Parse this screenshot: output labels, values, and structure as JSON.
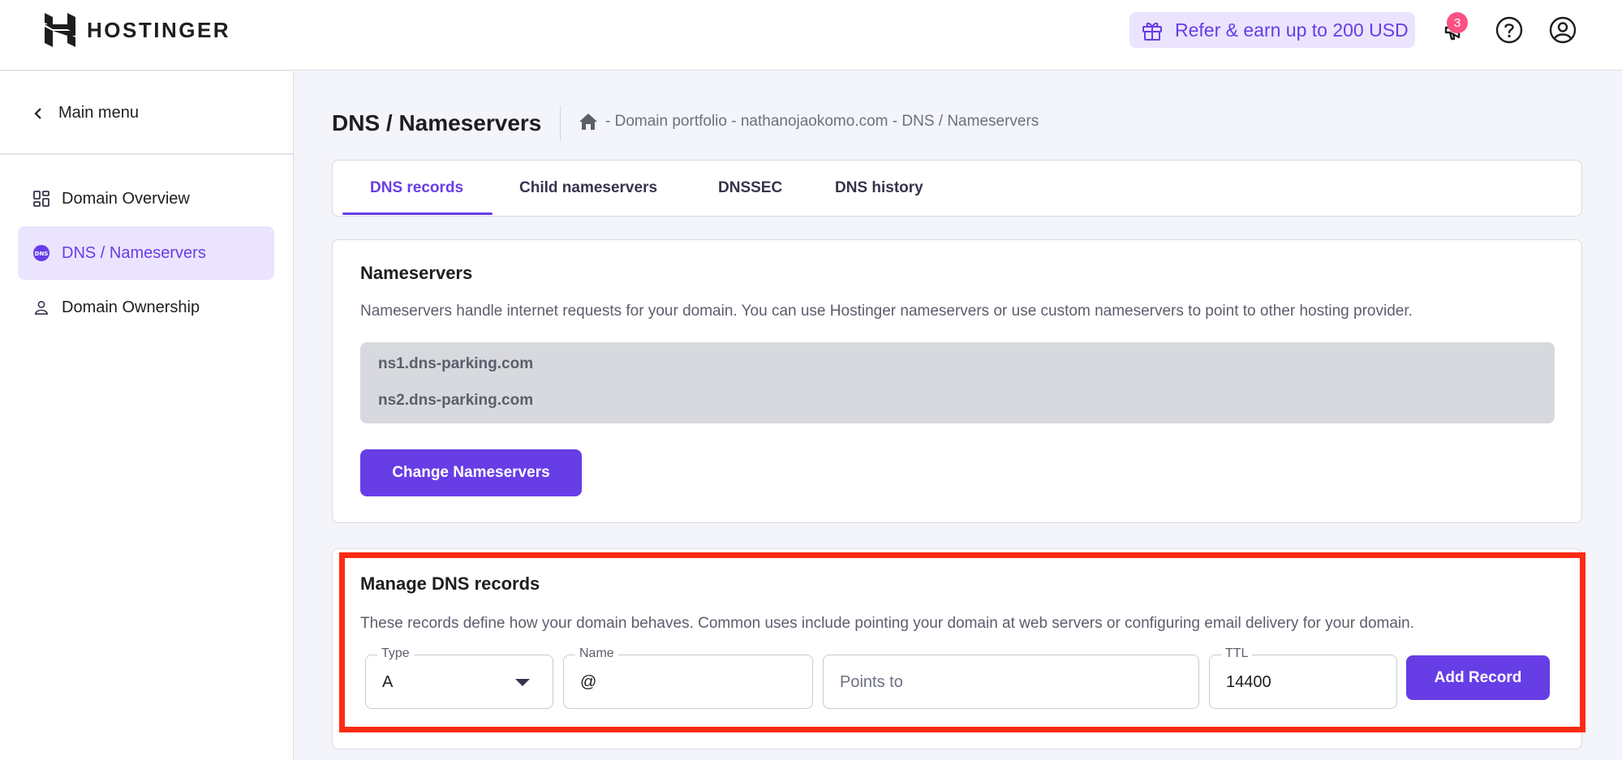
{
  "brand": {
    "name": "HOSTINGER"
  },
  "topbar": {
    "refer_label": "Refer & earn up to 200 USD",
    "notification_count": "3"
  },
  "sidebar": {
    "main_menu": "Main menu",
    "items": [
      {
        "label": "Domain Overview",
        "icon": "grid-icon",
        "active": false
      },
      {
        "label": "DNS / Nameservers",
        "icon": "dns-icon",
        "active": true
      },
      {
        "label": "Domain Ownership",
        "icon": "user-icon",
        "active": false
      }
    ]
  },
  "header": {
    "title": "DNS / Nameservers",
    "breadcrumb": "- Domain portfolio - nathanojaokomo.com - DNS / Nameservers"
  },
  "tabs": [
    {
      "label": "DNS records",
      "active": true
    },
    {
      "label": "Child nameservers",
      "active": false
    },
    {
      "label": "DNSSEC",
      "active": false
    },
    {
      "label": "DNS history",
      "active": false
    }
  ],
  "nameservers": {
    "title": "Nameservers",
    "description": "Nameservers handle internet requests for your domain. You can use Hostinger nameservers or use custom nameservers to point to other hosting provider.",
    "servers": [
      "ns1.dns-parking.com",
      "ns2.dns-parking.com"
    ],
    "button": "Change Nameservers"
  },
  "manage_dns": {
    "title": "Manage DNS records",
    "description": "These records define how your domain behaves. Common uses include pointing your domain at web servers or configuring email delivery for your domain.",
    "type_label": "Type",
    "type_value": "A",
    "name_label": "Name",
    "name_value": "@",
    "points_to_placeholder": "Points to",
    "ttl_label": "TTL",
    "ttl_value": "14400",
    "button": "Add Record"
  },
  "colors": {
    "accent": "#673de6",
    "accent_light": "#ebe4ff",
    "highlight": "#ff2a14",
    "badge": "#fc5185"
  }
}
